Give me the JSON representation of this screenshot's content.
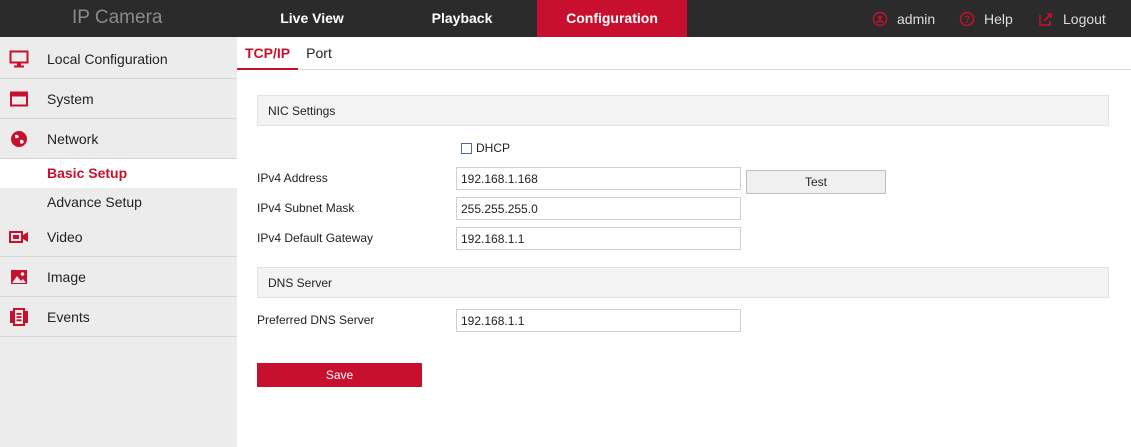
{
  "header": {
    "brand": "IP Camera",
    "nav": [
      {
        "label": "Live View"
      },
      {
        "label": "Playback"
      },
      {
        "label": "Configuration",
        "active": true
      }
    ],
    "user": "admin",
    "help": "Help",
    "logout": "Logout",
    "accent_color": "#c8102e"
  },
  "sidebar": {
    "items": [
      {
        "label": "Local Configuration",
        "icon": "monitor-icon"
      },
      {
        "label": "System",
        "icon": "system-window-icon"
      },
      {
        "label": "Network",
        "icon": "network-globe-icon"
      },
      {
        "label": "Video",
        "icon": "video-camera-icon"
      },
      {
        "label": "Image",
        "icon": "image-icon"
      },
      {
        "label": "Events",
        "icon": "events-list-icon"
      }
    ],
    "network_sub": [
      {
        "label": "Basic Setup",
        "active": true
      },
      {
        "label": "Advance Setup"
      }
    ]
  },
  "tabs": [
    {
      "label": "TCP/IP",
      "active": true
    },
    {
      "label": "Port"
    }
  ],
  "nic": {
    "title": "NIC Settings",
    "dhcp_label": "DHCP",
    "dhcp_checked": false,
    "ipv4_address_label": "IPv4 Address",
    "ipv4_address": "192.168.1.168",
    "test_label": "Test",
    "subnet_label": "IPv4 Subnet Mask",
    "subnet": "255.255.255.0",
    "gateway_label": "IPv4 Default Gateway",
    "gateway": "192.168.1.1"
  },
  "dns": {
    "title": "DNS Server",
    "preferred_label": "Preferred DNS Server",
    "preferred": "192.168.1.1"
  },
  "save_label": "Save"
}
